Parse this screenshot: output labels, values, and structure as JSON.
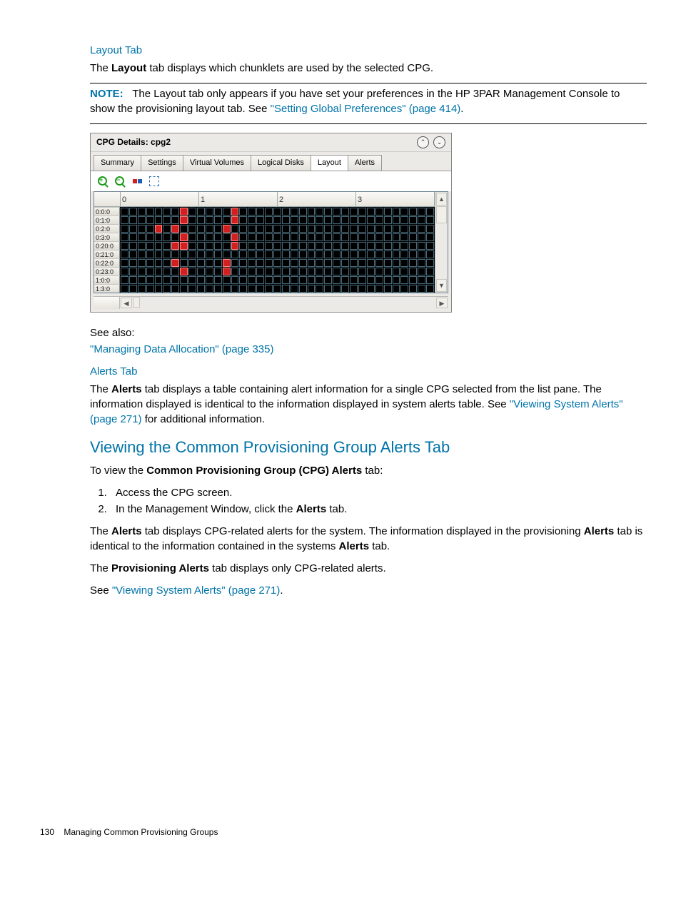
{
  "page": {
    "number": "130",
    "footer": "Managing Common Provisioning Groups"
  },
  "section1": {
    "heading": "Layout Tab",
    "p1_a": "The ",
    "p1_b": "Layout",
    "p1_c": " tab displays which chunklets are used by the selected CPG.",
    "note_label": "NOTE:",
    "note_text_a": "The Layout tab only appears if you have set your preferences in the HP 3PAR Management Console to show the provisioning layout tab. See ",
    "note_link": "\"Setting Global Preferences\" (page 414)",
    "note_text_b": "."
  },
  "screenshot": {
    "title": "CPG Details: cpg2",
    "tabs": [
      "Summary",
      "Settings",
      "Virtual Volumes",
      "Logical Disks",
      "Layout",
      "Alerts"
    ],
    "activeTab": "Layout",
    "cols": [
      "0",
      "1",
      "2",
      "3"
    ],
    "rows": [
      {
        "label": "0:0:0",
        "red": [
          7,
          13
        ]
      },
      {
        "label": "0:1:0",
        "red": [
          7,
          13
        ]
      },
      {
        "label": "0:2:0",
        "red": [
          4,
          6,
          12
        ]
      },
      {
        "label": "0:3:0",
        "red": [
          7,
          13
        ]
      },
      {
        "label": "0:20:0",
        "red": [
          6,
          7,
          13
        ]
      },
      {
        "label": "0:21:0",
        "red": []
      },
      {
        "label": "0:22:0",
        "red": [
          6,
          12
        ]
      },
      {
        "label": "0:23:0",
        "red": [
          7,
          12
        ]
      },
      {
        "label": "1:0:0",
        "red": []
      },
      {
        "label": "1:3:0",
        "red": []
      }
    ],
    "cellsPerRow": 37
  },
  "afterShot": {
    "seealso": "See also:",
    "link1": "\"Managing Data Allocation\" (page 335)"
  },
  "section2": {
    "heading": "Alerts Tab",
    "p_a": "The ",
    "p_b": "Alerts",
    "p_c": " tab displays a table containing alert information for a single CPG selected from the list pane. The information displayed is identical to the information displayed in system alerts table. See ",
    "p_link": "\"Viewing System Alerts\" (page 271)",
    "p_d": " for additional information."
  },
  "section3": {
    "heading": "Viewing the Common Provisioning Group Alerts Tab",
    "intro_a": "To view the ",
    "intro_b": "Common Provisioning Group (CPG) Alerts",
    "intro_c": " tab:",
    "steps": [
      "Access the CPG screen.",
      {
        "a": "In the Management Window, click the ",
        "b": "Alerts",
        "c": " tab."
      }
    ],
    "p2_a": "The ",
    "p2_b": "Alerts",
    "p2_c": " tab displays CPG-related alerts for the system. The information displayed in the provisioning ",
    "p2_d": "Alerts",
    "p2_e": " tab is identical to the information contained in the systems ",
    "p2_f": "Alerts",
    "p2_g": " tab.",
    "p3_a": "The ",
    "p3_b": "Provisioning Alerts",
    "p3_c": " tab displays only CPG-related alerts.",
    "p4_a": "See ",
    "p4_link": "\"Viewing System Alerts\" (page 271)",
    "p4_b": "."
  }
}
